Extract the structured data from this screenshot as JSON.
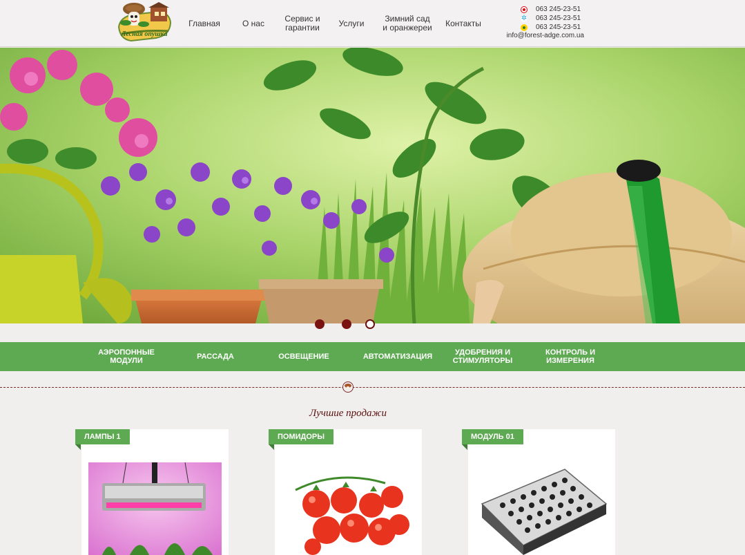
{
  "header": {
    "logo_text": "Лесная опушка",
    "nav": [
      {
        "label": "Главная"
      },
      {
        "label": "О нас"
      },
      {
        "label": "Сервис и\nгарантии"
      },
      {
        "label": "Услуги"
      },
      {
        "label": "Зимний сад\nи оранжереи"
      },
      {
        "label": "Контакты"
      }
    ],
    "phones": [
      {
        "number": "063 245-23-51",
        "icon": "mts-icon"
      },
      {
        "number": "063 245-23-51",
        "icon": "kyivstar-icon"
      },
      {
        "number": "063 245-23-51",
        "icon": "lifecell-icon"
      }
    ],
    "email": "info@forest-adge.com.ua"
  },
  "slider": {
    "slides": 3,
    "active_index": 3
  },
  "categories": [
    {
      "label": "Аэропонные\nмодули"
    },
    {
      "label": "Рассада"
    },
    {
      "label": "Освещение"
    },
    {
      "label": "Автоматизация"
    },
    {
      "label": "Удобрения и\nстимуляторы"
    },
    {
      "label": "Контроль и\nизмерения"
    }
  ],
  "section": {
    "title": "Лучшие продажи"
  },
  "products": [
    {
      "tag": "Лампы 1",
      "image": "grow-lamp-image"
    },
    {
      "tag": "Помидоры",
      "image": "tomatoes-image"
    },
    {
      "tag": "Модуль 01",
      "image": "seedling-tray-image"
    }
  ],
  "colors": {
    "accent_green": "#5eaa52",
    "brand_maroon": "#6b0f0f",
    "background": "#f1eeee"
  }
}
